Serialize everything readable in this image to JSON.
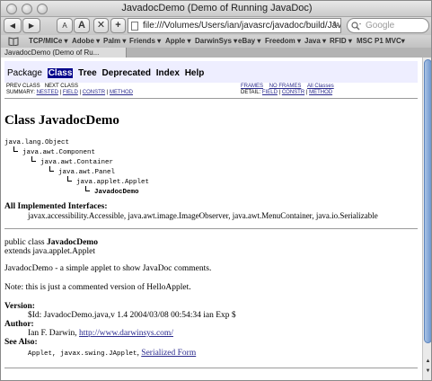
{
  "window": {
    "title": "JavadocDemo (Demo of Running JavaDoc)"
  },
  "toolbar": {
    "back_icon": "◀",
    "forward_icon": "▶",
    "text_smaller": "A",
    "text_bigger": "A",
    "stop_icon": "✕",
    "add_icon": "+",
    "url": "file:///Volumes/Users/ian/javasrc/javadoc/build/JavadocDemo",
    "search_placeholder": "Google"
  },
  "bookmarks": [
    "TCP/MICe ▾",
    "Adobe ▾",
    "Palm ▾",
    "Friends ▾",
    "Apple ▾",
    "DarwinSys ▾",
    "eBay ▾",
    "Freedom ▾",
    "Java ▾",
    "RFID ▾",
    "MSC P1 MVC▾"
  ],
  "tab": {
    "label": "JavadocDemo (Demo of Ru..."
  },
  "nav": {
    "items": [
      "Package",
      "Class",
      "Tree",
      "Deprecated",
      "Index",
      "Help"
    ],
    "prev_class": "PREV CLASS",
    "next_class": "NEXT CLASS",
    "frames": "FRAMES",
    "no_frames": "NO FRAMES",
    "all_classes": "All Classes",
    "summary_label": "SUMMARY:",
    "summary_nested": "NESTED",
    "summary_field": "FIELD",
    "summary_constr": "CONSTR",
    "summary_method": "METHOD",
    "detail_label": "DETAIL:",
    "detail_field": "FIELD",
    "detail_constr": "CONSTR",
    "detail_method": "METHOD",
    "sep": "|"
  },
  "page": {
    "title": "Class JavadocDemo",
    "hierarchy": [
      "java.lang.Object",
      "java.awt.Component",
      "java.awt.Container",
      "java.awt.Panel",
      "java.applet.Applet",
      "JavadocDemo"
    ],
    "interfaces_label": "All Implemented Interfaces:",
    "interfaces": "javax.accessibility.Accessible, java.awt.image.ImageObserver, java.awt.MenuContainer, java.io.Serializable",
    "decl_prefix": "public class ",
    "decl_name": "JavadocDemo",
    "decl_extends": "extends java.applet.Applet",
    "description": "JavadocDemo - a simple applet to show JavaDoc comments.",
    "note": "Note: this is just a commented version of HelloApplet.",
    "version_label": "Version:",
    "version_value": "$Id: JavadocDemo.java,v 1.4 2004/03/08 00:54:34 ian Exp $",
    "author_label": "Author:",
    "author_name": "Ian F. Darwin, ",
    "author_url": "http://www.darwinsys.com/",
    "see_also_label": "See Also:",
    "see_also_code": "Applet, javax.swing.JApplet",
    "see_also_sep": ", ",
    "see_also_link": "Serialized Form"
  }
}
